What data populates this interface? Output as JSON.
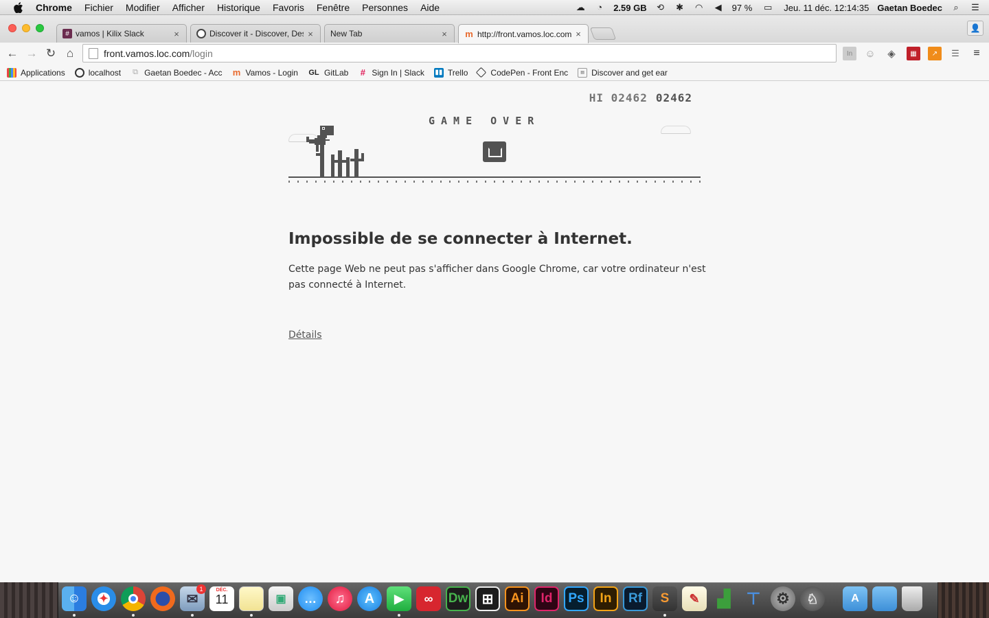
{
  "menubar": {
    "app_name": "Chrome",
    "items": [
      "Fichier",
      "Modifier",
      "Afficher",
      "Historique",
      "Favoris",
      "Fenêtre",
      "Personnes",
      "Aide"
    ],
    "memory": "2.59 GB",
    "battery": "97 %",
    "datetime": "Jeu. 11 déc.  12:14:35",
    "user": "Gaetan Boedec"
  },
  "tabs": [
    {
      "label": "vamos | Kilix Slack",
      "favicon_color": "#6b2c4f"
    },
    {
      "label": "Discover it - Discover, Desi",
      "favicon_color": "#444444"
    },
    {
      "label": "New Tab",
      "favicon_color": ""
    },
    {
      "label": "http://front.vamos.loc.com/",
      "favicon_color": "#e8692d"
    }
  ],
  "omnibox": {
    "host": "front.vamos.loc.com",
    "path": "/login"
  },
  "bookmarks": [
    {
      "label": "Applications"
    },
    {
      "label": "localhost"
    },
    {
      "label": "Gaetan Boedec - Acc"
    },
    {
      "label": "Vamos - Login"
    },
    {
      "label": "GitLab"
    },
    {
      "label": "Sign In | Slack"
    },
    {
      "label": "Trello"
    },
    {
      "label": "CodePen - Front Enc"
    },
    {
      "label": "Discover and get ear"
    }
  ],
  "game": {
    "hi_label": "HI",
    "hi_score": "02462",
    "score": "02462",
    "game_over": "GAME OVER"
  },
  "error": {
    "title": "Impossible de se connecter à Internet.",
    "description": "Cette page Web ne peut pas s'afficher dans Google Chrome, car votre ordinateur n'est pas connecté à Internet.",
    "details_link": "Détails"
  },
  "dock": {
    "mail_badge": "1",
    "calendar_month": "DÉC.",
    "calendar_day": "11",
    "apps": [
      "finder-icon",
      "safari-icon",
      "chrome-icon",
      "firefox-icon",
      "mail-icon",
      "calendar-icon",
      "notes-icon",
      "preview-icon",
      "messages-icon",
      "itunes-icon",
      "app-store-icon",
      "facetime-icon",
      "creative-cloud-icon",
      "dreamweaver-icon",
      "edge-icon",
      "illustrator-icon",
      "indesign-icon",
      "photoshop-icon",
      "incopy-icon",
      "reflector-icon",
      "sublime-icon",
      "textedit-icon",
      "numbers-icon",
      "keynote-icon",
      "system-preferences-icon",
      "kiwi-icon",
      "applications-folder-icon",
      "documents-folder-icon",
      "trash-icon"
    ]
  }
}
